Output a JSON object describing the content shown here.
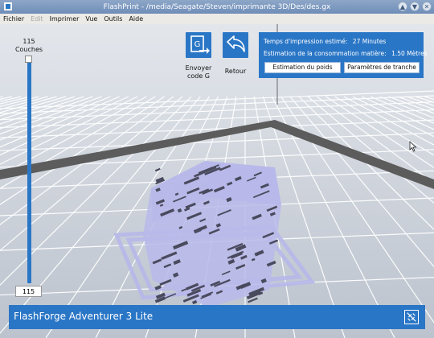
{
  "window": {
    "title": "FlashPrint - /media/Seagate/Steven/imprimante 3D/Des/des.gx",
    "buttons": [
      "▲",
      "▼",
      "✕"
    ]
  },
  "menu": [
    "Fichier",
    "Edit",
    "Imprimer",
    "Vue",
    "Outils",
    "Aide"
  ],
  "layers": {
    "count": "115",
    "label": "Couches",
    "input_value": "115"
  },
  "toolbar": {
    "send_gcode_label": "Envoyer code G",
    "send_gcode_icon_text": "G",
    "back_label": "Retour"
  },
  "info": {
    "print_time_label": "Temps d'impression estimé:",
    "print_time_value": "27 Minutes",
    "material_label": "Estimation de la consommation matière:",
    "material_value": "1.50 Mètres",
    "weight_button": "Estimation du poids",
    "slice_params_button": "Paramètres de tranche"
  },
  "status": {
    "printer_name": "FlashForge Adventurer 3 Lite"
  },
  "colors": {
    "accent": "#2a76c6",
    "model": "#b8b8ea",
    "model_shadow": "#4a4a5e",
    "build_plate_border": "#5c5c5c",
    "grid": "#ffffff"
  }
}
